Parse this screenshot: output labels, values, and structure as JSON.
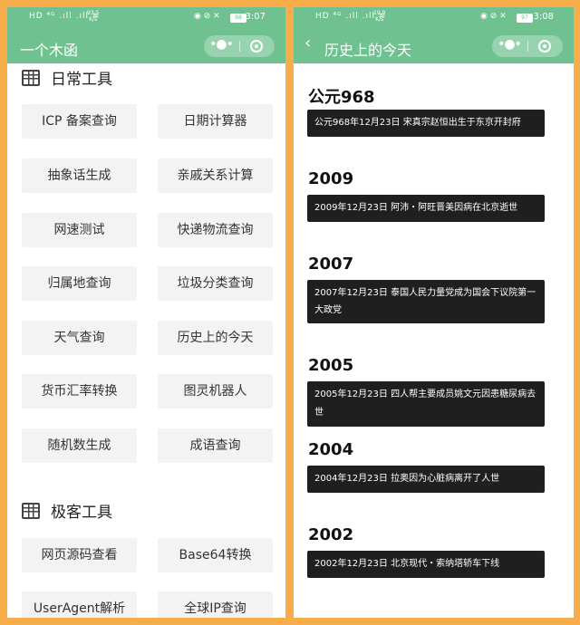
{
  "left_screen": {
    "status": {
      "signal": "HD ⁴ᴳ .ıll .ıll ≋",
      "speed_value": "93.5",
      "speed_unit": "K/s",
      "icons": "◉ ⊘ ✕",
      "battery": "98",
      "time": "3:07"
    },
    "title": "一个木函",
    "capsule": {
      "more": "•●•"
    },
    "sections": [
      {
        "title": "日常工具",
        "items": [
          "ICP 备案查询",
          "日期计算器",
          "抽象话生成",
          "亲戚关系计算",
          "网速测试",
          "快递物流查询",
          "归属地查询",
          "垃圾分类查询",
          "天气查询",
          "历史上的今天",
          "货币汇率转换",
          "图灵机器人",
          "随机数生成",
          "成语查询"
        ]
      },
      {
        "title": "极客工具",
        "items": [
          "网页源码查看",
          "Base64转换",
          "UserAgent解析",
          "全球IP查询"
        ]
      }
    ]
  },
  "right_screen": {
    "status": {
      "signal": "HD ⁴ᴳ .ıll .ıll ≋",
      "speed_value": "19.9",
      "speed_unit": "K/s",
      "icons": "◉ ⊘ ✕",
      "battery": "97",
      "time": "3:08"
    },
    "back": "‹",
    "title": "历史上的今天",
    "capsule": {
      "more": "•●•"
    },
    "events": [
      {
        "year": "公元968",
        "text": "公元968年12月23日 宋真宗赵恒出生于东京开封府"
      },
      {
        "year": "2009",
        "text": "2009年12月23日 阿沛・阿旺晋美因病在北京逝世"
      },
      {
        "year": "2007",
        "text": "2007年12月23日 泰国人民力量党成为国会下议院第一大政党"
      },
      {
        "year": "2005",
        "text": "2005年12月23日 四人帮主要成员姚文元因患糖尿病去世"
      },
      {
        "year": "2004",
        "text": "2004年12月23日 拉奥因为心脏病离开了人世"
      },
      {
        "year": "2002",
        "text": "2002年12月23日 北京现代・索纳塔轿车下线"
      }
    ]
  }
}
